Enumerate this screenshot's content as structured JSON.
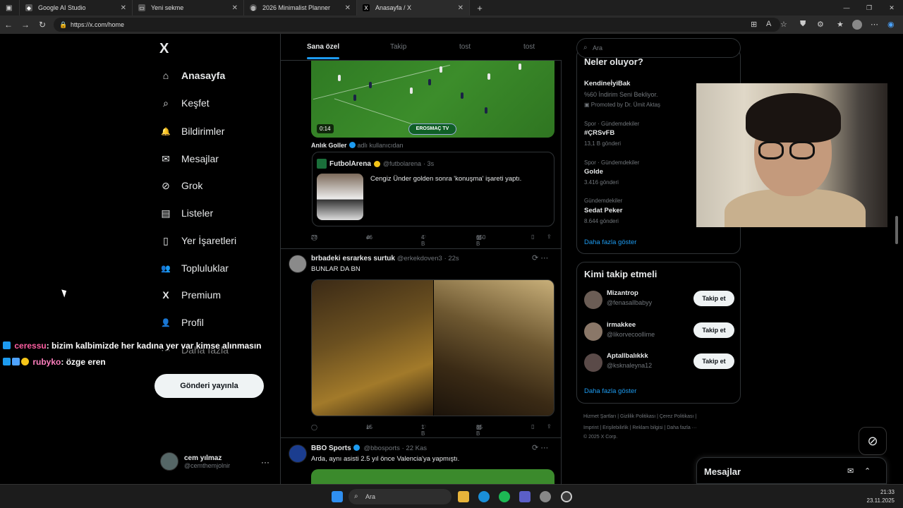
{
  "browser": {
    "tabs": [
      {
        "label": "Google AI Studio",
        "active": false
      },
      {
        "label": "Yeni sekme",
        "active": false
      },
      {
        "label": "2026 Minimalist Planner",
        "active": false
      },
      {
        "label": "Anasayfa / X",
        "active": true
      }
    ],
    "new_tab": "+",
    "url": "https://x.com/home"
  },
  "left_nav": {
    "logo": "X",
    "items": [
      {
        "label": "Anasayfa",
        "icon": "home-icon",
        "glyph": "⌂"
      },
      {
        "label": "Keşfet",
        "icon": "search-icon",
        "glyph": "⌕"
      },
      {
        "label": "Bildirimler",
        "icon": "bell-icon",
        "glyph": "🔔"
      },
      {
        "label": "Mesajlar",
        "icon": "mail-icon",
        "glyph": "✉"
      },
      {
        "label": "Grok",
        "icon": "grok-icon",
        "glyph": "⊘"
      },
      {
        "label": "Listeler",
        "icon": "list-icon",
        "glyph": "▤"
      },
      {
        "label": "Yer İşaretleri",
        "icon": "bookmark-icon",
        "glyph": "▯"
      },
      {
        "label": "Topluluklar",
        "icon": "communities-icon",
        "glyph": "👥"
      },
      {
        "label": "Premium",
        "icon": "premium-icon",
        "glyph": "X"
      },
      {
        "label": "Profil",
        "icon": "profile-icon",
        "glyph": "👤"
      },
      {
        "label": "Daha fazla",
        "icon": "more-icon",
        "glyph": "⋯"
      }
    ],
    "post_button": "Gönderi yayınla",
    "account": {
      "name": "cem yılmaz",
      "handle": "@cemthemjolnir",
      "more": "···"
    }
  },
  "chat_overlay": [
    {
      "user": "ceressu",
      "text": ": bizim kalbimizde her kadına yer var kimse alınmasın"
    },
    {
      "user": "rubyko",
      "text": ": özge eren"
    }
  ],
  "timeline": {
    "tabs": [
      "Sana özel",
      "Takip",
      "tost",
      "tost"
    ],
    "video1": {
      "duration": "0:14",
      "watermark": "EROSMAÇ TV"
    },
    "tweet1": {
      "retweet_user": "Anlık Goller",
      "retweet_suffix": "adlı kullanıcıdan",
      "quote": {
        "name": "FutbolArena",
        "handle": "@futbolarena",
        "time": "· 3s",
        "text": "Cengiz Ünder golden sonra 'konuşma' işareti yaptı."
      },
      "replies": "28",
      "reposts": "46",
      "likes": "4 B",
      "views": "650 B"
    },
    "tweet2": {
      "name": "brbadeki esrarkes surtuk",
      "handle": "@erkekdoven3",
      "time": "· 22s",
      "text": "BUNLAR DA BN",
      "replies": "",
      "reposts": "15",
      "likes": "1 B",
      "views": "85 B"
    },
    "tweet3": {
      "name": "BBO Sports",
      "handle": "@bbosports",
      "time": "· 22 Kas",
      "text": "Arda, aynı asisti 2.5 yıl önce Valencia'ya yapmıştı."
    }
  },
  "right_col": {
    "search_placeholder": "Ara",
    "trends": {
      "title": "Neler oluyor?",
      "promo": {
        "name": "KendineİyiBak",
        "desc": "%60 İndirim Seni Bekliyor.",
        "promoted": "Promoted by Dr. Ümit Aktaş"
      },
      "items": [
        {
          "cat": "Spor · Gündemdekiler",
          "name": "#ÇRSvFB",
          "count": "13,1 B gönderi"
        },
        {
          "cat": "Spor · Gündemdekiler",
          "name": "Golde",
          "count": "3.416 gönderi"
        },
        {
          "cat": "Gündemdekiler",
          "name": "Sedat Peker",
          "count": "8.644 gönderi"
        }
      ],
      "show_more": "Daha fazla göster"
    },
    "who_to_follow": {
      "title": "Kimi takip etmeli",
      "users": [
        {
          "name": "Mizantrop",
          "handle": "@fenasallbabyy",
          "button": "Takip et"
        },
        {
          "name": "irmakkee",
          "handle": "@likorvecoollime",
          "button": "Takip et"
        },
        {
          "name": "Aptallbalıkkk",
          "handle": "@ksknaleyna12",
          "button": "Takip et"
        }
      ],
      "show_more": "Daha fazla göster"
    },
    "footer": {
      "line1": "Hizmet Şartları  |  Gizlilik Politikası  |  Çerez Politikası  |",
      "line2": "Imprint  |  Erişilebilirlik  |  Reklam bilgisi  |  Daha fazla ···",
      "line3": "© 2025 X Corp."
    },
    "messages_title": "Mesajlar"
  },
  "taskbar": {
    "search": "Ara",
    "time": "21:33",
    "date": "23.11.2025"
  },
  "colors": {
    "accent": "#1d9bf0",
    "bg": "#000000",
    "text": "#e7e9ea",
    "muted": "#71767b"
  }
}
